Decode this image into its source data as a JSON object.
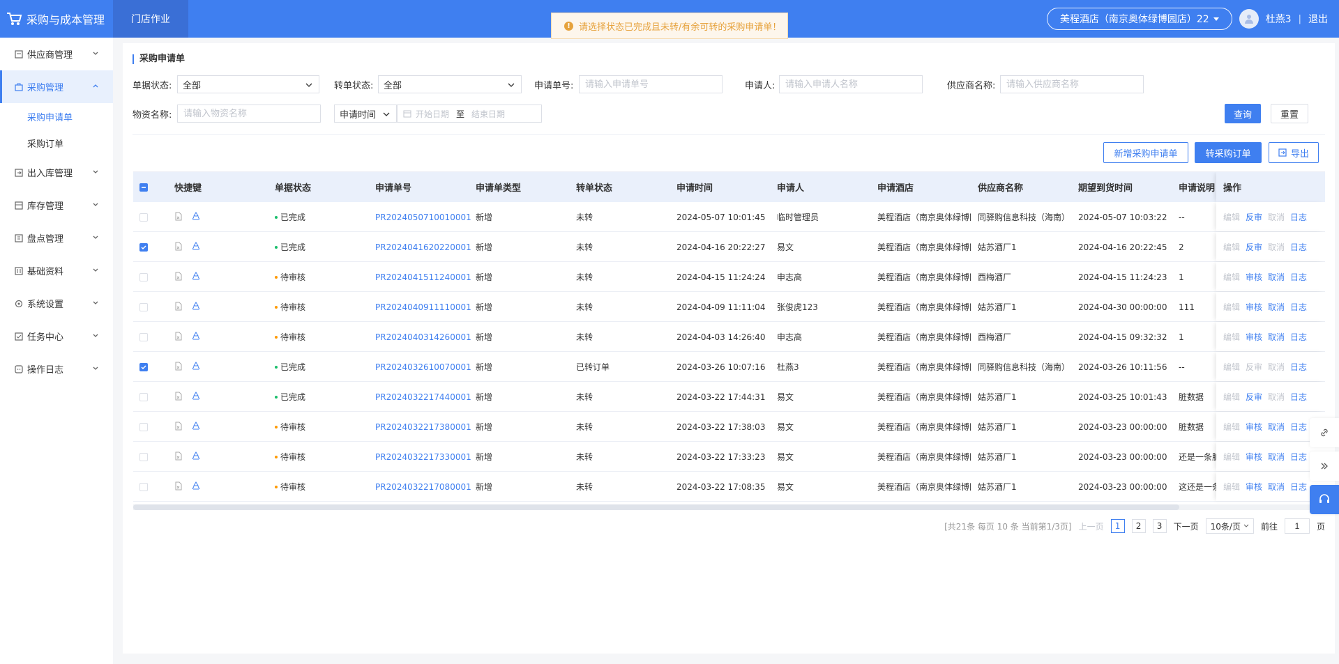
{
  "app": {
    "title": "采购与成本管理",
    "top_tab": "门店作业"
  },
  "header": {
    "hotel": "美程酒店（南京奥体绿博园店）22",
    "user": "杜燕3",
    "separator": "|",
    "logout": "退出"
  },
  "toast": {
    "message": "请选择状态已完成且未转/有余可转的采购申请单！"
  },
  "sidebar": {
    "items": [
      {
        "label": "供应商管理"
      },
      {
        "label": "采购管理"
      },
      {
        "label": "出入库管理"
      },
      {
        "label": "库存管理"
      },
      {
        "label": "盘点管理"
      },
      {
        "label": "基础资料"
      },
      {
        "label": "系统设置"
      },
      {
        "label": "任务中心"
      },
      {
        "label": "操作日志"
      }
    ],
    "sub_items": [
      {
        "label": "采购申请单"
      },
      {
        "label": "采购订单"
      }
    ]
  },
  "section_title": "采购申请单",
  "filters": {
    "doc_status_label": "单据状态:",
    "doc_status_value": "全部",
    "transfer_status_label": "转单状态:",
    "transfer_status_value": "全部",
    "req_no_label": "申请单号:",
    "req_no_placeholder": "请输入申请单号",
    "applicant_label": "申请人:",
    "applicant_placeholder": "请输入申请人名称",
    "supplier_label": "供应商名称:",
    "supplier_placeholder": "请输入供应商名称",
    "material_label": "物资名称:",
    "material_placeholder": "请输入物资名称",
    "time_type": "申请时间",
    "start_placeholder": "开始日期",
    "range_sep": "至",
    "end_placeholder": "结束日期"
  },
  "buttons": {
    "query": "查询",
    "reset": "重置",
    "add": "新增采购申请单",
    "convert": "转采购订单",
    "export": "导出"
  },
  "table": {
    "columns": [
      "快捷键",
      "单据状态",
      "申请单号",
      "申请单类型",
      "转单状态",
      "申请时间",
      "申请人",
      "申请酒店",
      "供应商名称",
      "期望到货时间",
      "申请说明",
      "操作"
    ],
    "ops": {
      "edit": "编辑",
      "reverse": "反审",
      "audit": "审核",
      "cancel": "取消",
      "log": "日志"
    },
    "status_colors": {
      "已完成": "#19be6b",
      "待审核": "#ff9900"
    },
    "rows": [
      {
        "checked": false,
        "status": "已完成",
        "no": "PR2024050710010001",
        "type": "新增",
        "transfer": "未转",
        "time": "2024-05-07 10:01:45",
        "applicant": "临时管理员",
        "hotel": "美程酒店（南京奥体绿博园店）",
        "supplier": "同驿购信息科技（海南）",
        "expect": "2024-05-07 10:03:22",
        "note": "--",
        "op2": "反审",
        "cancel_enabled": false
      },
      {
        "checked": true,
        "status": "已完成",
        "no": "PR2024041620220001",
        "type": "新增",
        "transfer": "未转",
        "time": "2024-04-16 20:22:27",
        "applicant": "易文",
        "hotel": "美程酒店（南京奥体绿博园店）",
        "supplier": "姑苏酒厂1",
        "expect": "2024-04-16 20:22:45",
        "note": "2",
        "op2": "反审",
        "cancel_enabled": false
      },
      {
        "checked": false,
        "status": "待审核",
        "no": "PR2024041511240001",
        "type": "新增",
        "transfer": "未转",
        "time": "2024-04-15 11:24:24",
        "applicant": "申志高",
        "hotel": "美程酒店（南京奥体绿博园店）",
        "supplier": "西梅酒厂",
        "expect": "2024-04-15 11:24:23",
        "note": "1",
        "op2": "审核",
        "cancel_enabled": true
      },
      {
        "checked": false,
        "status": "待审核",
        "no": "PR2024040911110001",
        "type": "新增",
        "transfer": "未转",
        "time": "2024-04-09 11:11:04",
        "applicant": "张俊虎123",
        "hotel": "美程酒店（南京奥体绿博园店）",
        "supplier": "姑苏酒厂1",
        "expect": "2024-04-30 00:00:00",
        "note": "111",
        "op2": "审核",
        "cancel_enabled": true
      },
      {
        "checked": false,
        "status": "待审核",
        "no": "PR2024040314260001",
        "type": "新增",
        "transfer": "未转",
        "time": "2024-04-03 14:26:40",
        "applicant": "申志高",
        "hotel": "美程酒店（南京奥体绿博园店）",
        "supplier": "西梅酒厂",
        "expect": "2024-04-15 09:32:32",
        "note": "1",
        "op2": "审核",
        "cancel_enabled": true
      },
      {
        "checked": true,
        "status": "已完成",
        "no": "PR2024032610070001",
        "type": "新增",
        "transfer": "已转订单",
        "time": "2024-03-26 10:07:16",
        "applicant": "杜燕3",
        "hotel": "美程酒店（南京奥体绿博园店）",
        "supplier": "同驿购信息科技（海南）",
        "expect": "2024-03-26 10:11:56",
        "note": "--",
        "op2": "反审",
        "cancel_enabled": false,
        "op2_disabled": true
      },
      {
        "checked": false,
        "status": "已完成",
        "no": "PR2024032217440001",
        "type": "新增",
        "transfer": "未转",
        "time": "2024-03-22 17:44:31",
        "applicant": "易文",
        "hotel": "美程酒店（南京奥体绿博园店）",
        "supplier": "姑苏酒厂1",
        "expect": "2024-03-25 10:01:43",
        "note": "脏数据",
        "op2": "反审",
        "cancel_enabled": false
      },
      {
        "checked": false,
        "status": "待审核",
        "no": "PR2024032217380001",
        "type": "新增",
        "transfer": "未转",
        "time": "2024-03-22 17:38:03",
        "applicant": "易文",
        "hotel": "美程酒店（南京奥体绿博园店）",
        "supplier": "姑苏酒厂1",
        "expect": "2024-03-23 00:00:00",
        "note": "脏数据",
        "op2": "审核",
        "cancel_enabled": true
      },
      {
        "checked": false,
        "status": "待审核",
        "no": "PR2024032217330001",
        "type": "新增",
        "transfer": "未转",
        "time": "2024-03-22 17:33:23",
        "applicant": "易文",
        "hotel": "美程酒店（南京奥体绿博园店）",
        "supplier": "姑苏酒厂1",
        "expect": "2024-03-23 00:00:00",
        "note": "还是一条脏数据",
        "op2": "审核",
        "cancel_enabled": true
      },
      {
        "checked": false,
        "status": "待审核",
        "no": "PR2024032217080001",
        "type": "新增",
        "transfer": "未转",
        "time": "2024-03-22 17:08:35",
        "applicant": "易文",
        "hotel": "美程酒店（南京奥体绿博园店）",
        "supplier": "姑苏酒厂1",
        "expect": "2024-03-23 00:00:00",
        "note": "这还是一条脏数据",
        "op2": "审核",
        "cancel_enabled": true
      }
    ]
  },
  "pagination": {
    "summary": "[共21条 每页 10 条 当前第1/3页]",
    "prev": "上一页",
    "pages": [
      "1",
      "2",
      "3"
    ],
    "next": "下一页",
    "page_size": "10条/页",
    "goto": "前往",
    "goto_value": "1",
    "page_unit": "页"
  }
}
